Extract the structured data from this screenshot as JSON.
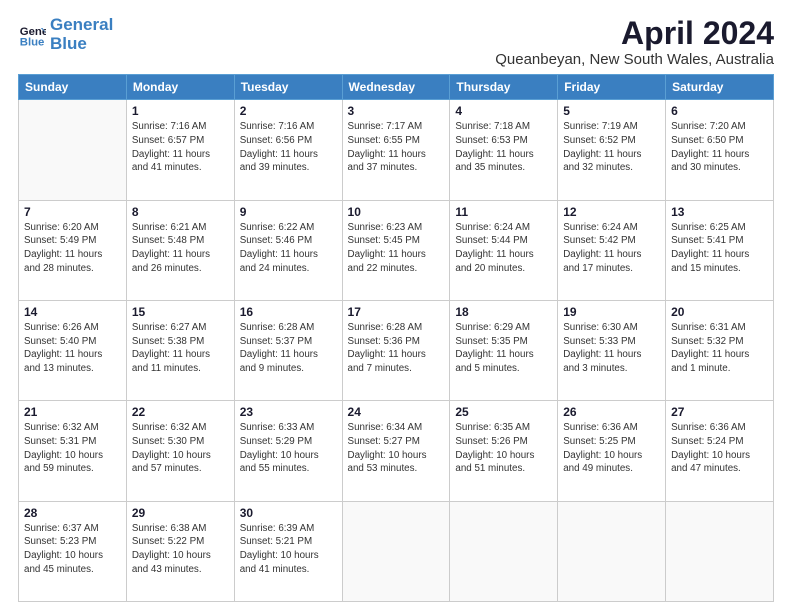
{
  "header": {
    "logo_line1": "General",
    "logo_line2": "Blue",
    "title": "April 2024",
    "subtitle": "Queanbeyan, New South Wales, Australia"
  },
  "calendar": {
    "days_of_week": [
      "Sunday",
      "Monday",
      "Tuesday",
      "Wednesday",
      "Thursday",
      "Friday",
      "Saturday"
    ],
    "weeks": [
      [
        {
          "day": "",
          "info": ""
        },
        {
          "day": "1",
          "info": "Sunrise: 7:16 AM\nSunset: 6:57 PM\nDaylight: 11 hours\nand 41 minutes."
        },
        {
          "day": "2",
          "info": "Sunrise: 7:16 AM\nSunset: 6:56 PM\nDaylight: 11 hours\nand 39 minutes."
        },
        {
          "day": "3",
          "info": "Sunrise: 7:17 AM\nSunset: 6:55 PM\nDaylight: 11 hours\nand 37 minutes."
        },
        {
          "day": "4",
          "info": "Sunrise: 7:18 AM\nSunset: 6:53 PM\nDaylight: 11 hours\nand 35 minutes."
        },
        {
          "day": "5",
          "info": "Sunrise: 7:19 AM\nSunset: 6:52 PM\nDaylight: 11 hours\nand 32 minutes."
        },
        {
          "day": "6",
          "info": "Sunrise: 7:20 AM\nSunset: 6:50 PM\nDaylight: 11 hours\nand 30 minutes."
        }
      ],
      [
        {
          "day": "7",
          "info": "Sunrise: 6:20 AM\nSunset: 5:49 PM\nDaylight: 11 hours\nand 28 minutes."
        },
        {
          "day": "8",
          "info": "Sunrise: 6:21 AM\nSunset: 5:48 PM\nDaylight: 11 hours\nand 26 minutes."
        },
        {
          "day": "9",
          "info": "Sunrise: 6:22 AM\nSunset: 5:46 PM\nDaylight: 11 hours\nand 24 minutes."
        },
        {
          "day": "10",
          "info": "Sunrise: 6:23 AM\nSunset: 5:45 PM\nDaylight: 11 hours\nand 22 minutes."
        },
        {
          "day": "11",
          "info": "Sunrise: 6:24 AM\nSunset: 5:44 PM\nDaylight: 11 hours\nand 20 minutes."
        },
        {
          "day": "12",
          "info": "Sunrise: 6:24 AM\nSunset: 5:42 PM\nDaylight: 11 hours\nand 17 minutes."
        },
        {
          "day": "13",
          "info": "Sunrise: 6:25 AM\nSunset: 5:41 PM\nDaylight: 11 hours\nand 15 minutes."
        }
      ],
      [
        {
          "day": "14",
          "info": "Sunrise: 6:26 AM\nSunset: 5:40 PM\nDaylight: 11 hours\nand 13 minutes."
        },
        {
          "day": "15",
          "info": "Sunrise: 6:27 AM\nSunset: 5:38 PM\nDaylight: 11 hours\nand 11 minutes."
        },
        {
          "day": "16",
          "info": "Sunrise: 6:28 AM\nSunset: 5:37 PM\nDaylight: 11 hours\nand 9 minutes."
        },
        {
          "day": "17",
          "info": "Sunrise: 6:28 AM\nSunset: 5:36 PM\nDaylight: 11 hours\nand 7 minutes."
        },
        {
          "day": "18",
          "info": "Sunrise: 6:29 AM\nSunset: 5:35 PM\nDaylight: 11 hours\nand 5 minutes."
        },
        {
          "day": "19",
          "info": "Sunrise: 6:30 AM\nSunset: 5:33 PM\nDaylight: 11 hours\nand 3 minutes."
        },
        {
          "day": "20",
          "info": "Sunrise: 6:31 AM\nSunset: 5:32 PM\nDaylight: 11 hours\nand 1 minute."
        }
      ],
      [
        {
          "day": "21",
          "info": "Sunrise: 6:32 AM\nSunset: 5:31 PM\nDaylight: 10 hours\nand 59 minutes."
        },
        {
          "day": "22",
          "info": "Sunrise: 6:32 AM\nSunset: 5:30 PM\nDaylight: 10 hours\nand 57 minutes."
        },
        {
          "day": "23",
          "info": "Sunrise: 6:33 AM\nSunset: 5:29 PM\nDaylight: 10 hours\nand 55 minutes."
        },
        {
          "day": "24",
          "info": "Sunrise: 6:34 AM\nSunset: 5:27 PM\nDaylight: 10 hours\nand 53 minutes."
        },
        {
          "day": "25",
          "info": "Sunrise: 6:35 AM\nSunset: 5:26 PM\nDaylight: 10 hours\nand 51 minutes."
        },
        {
          "day": "26",
          "info": "Sunrise: 6:36 AM\nSunset: 5:25 PM\nDaylight: 10 hours\nand 49 minutes."
        },
        {
          "day": "27",
          "info": "Sunrise: 6:36 AM\nSunset: 5:24 PM\nDaylight: 10 hours\nand 47 minutes."
        }
      ],
      [
        {
          "day": "28",
          "info": "Sunrise: 6:37 AM\nSunset: 5:23 PM\nDaylight: 10 hours\nand 45 minutes."
        },
        {
          "day": "29",
          "info": "Sunrise: 6:38 AM\nSunset: 5:22 PM\nDaylight: 10 hours\nand 43 minutes."
        },
        {
          "day": "30",
          "info": "Sunrise: 6:39 AM\nSunset: 5:21 PM\nDaylight: 10 hours\nand 41 minutes."
        },
        {
          "day": "",
          "info": ""
        },
        {
          "day": "",
          "info": ""
        },
        {
          "day": "",
          "info": ""
        },
        {
          "day": "",
          "info": ""
        }
      ]
    ]
  }
}
